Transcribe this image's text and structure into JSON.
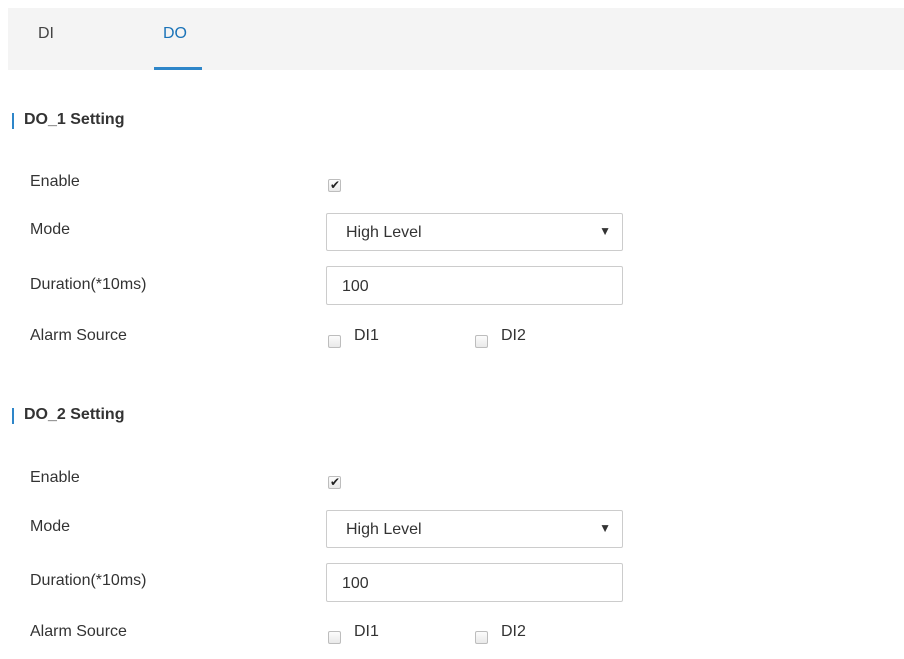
{
  "tabs": [
    {
      "label": "DI",
      "active": false
    },
    {
      "label": "DO",
      "active": true
    }
  ],
  "sections": [
    {
      "title": "DO_1 Setting",
      "enable_label": "Enable",
      "enable_checked": true,
      "mode_label": "Mode",
      "mode_value": "High Level",
      "duration_label": "Duration(*10ms)",
      "duration_value": "100",
      "alarm_label": "Alarm Source",
      "alarm_options": [
        {
          "label": "DI1",
          "checked": false
        },
        {
          "label": "DI2",
          "checked": false
        }
      ]
    },
    {
      "title": "DO_2 Setting",
      "enable_label": "Enable",
      "enable_checked": true,
      "mode_label": "Mode",
      "mode_value": "High Level",
      "duration_label": "Duration(*10ms)",
      "duration_value": "100",
      "alarm_label": "Alarm Source",
      "alarm_options": [
        {
          "label": "DI1",
          "checked": false
        },
        {
          "label": "DI2",
          "checked": false
        }
      ]
    }
  ],
  "colors": {
    "accent": "#2e86c9",
    "tab_bar_bg": "#f4f4f4"
  },
  "icons": {
    "checkmark": "checkmark-icon",
    "dropdown": "dropdown-arrow-icon"
  }
}
